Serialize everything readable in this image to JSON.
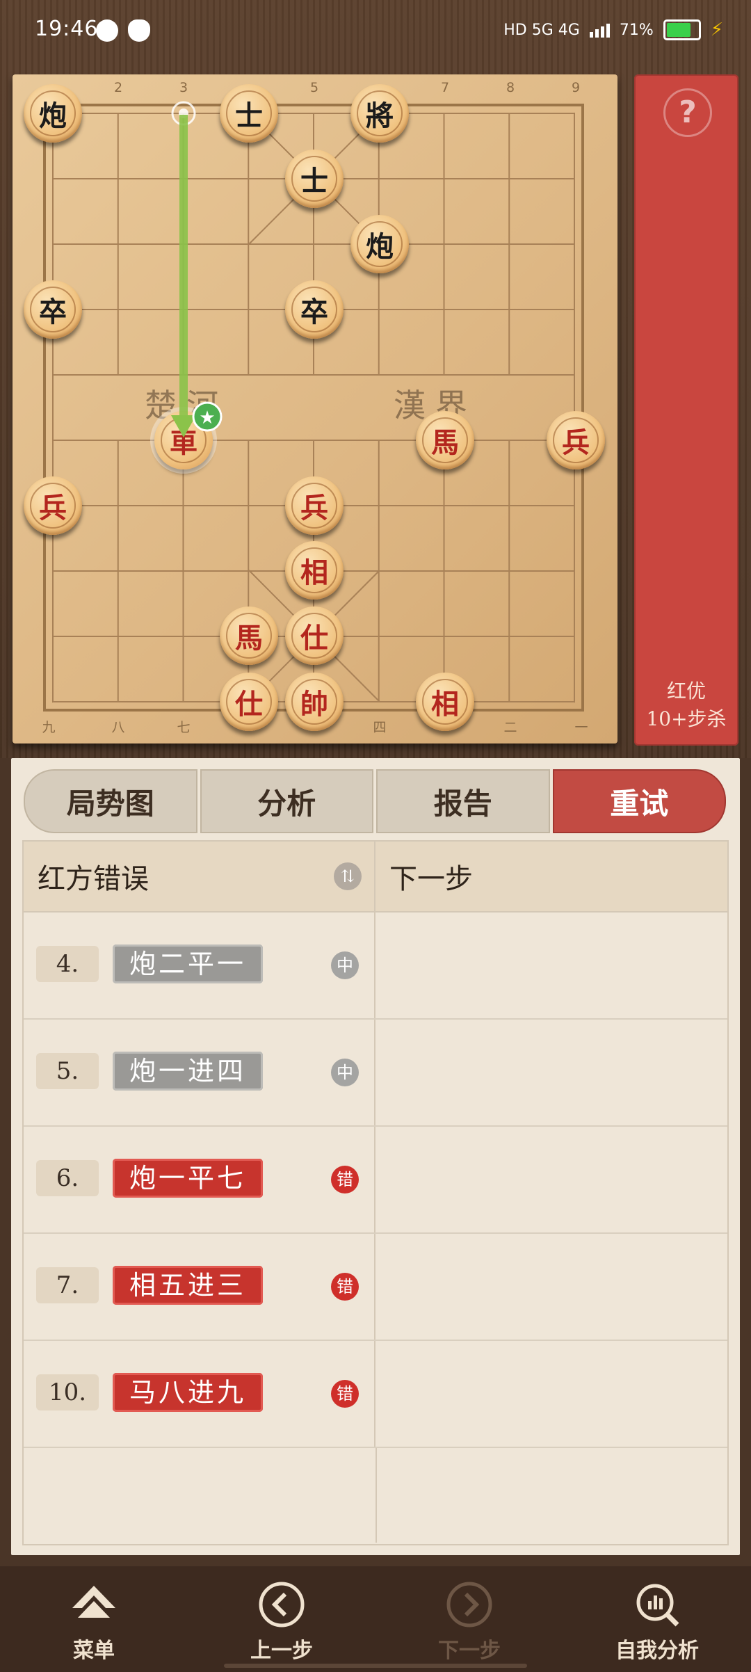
{
  "status_bar": {
    "time": "19:46",
    "network": "HD 5G 4G",
    "battery": "71%",
    "battery_level": 0.71
  },
  "board": {
    "top_file_labels": [
      "2",
      "3",
      "5",
      "7",
      "8",
      "9"
    ],
    "bottom_file_labels": [
      "九",
      "八",
      "七",
      "四",
      "二",
      "一"
    ],
    "river_left": "楚河",
    "river_right": "漢界",
    "pieces": [
      {
        "char": "炮",
        "side": "black",
        "name": "black-cannon"
      },
      {
        "char": "士",
        "side": "black",
        "name": "black-advisor"
      },
      {
        "char": "將",
        "side": "black",
        "name": "black-general"
      },
      {
        "char": "士",
        "side": "black",
        "name": "black-advisor"
      },
      {
        "char": "炮",
        "side": "black",
        "name": "black-cannon"
      },
      {
        "char": "卒",
        "side": "black",
        "name": "black-soldier"
      },
      {
        "char": "卒",
        "side": "black",
        "name": "black-soldier"
      },
      {
        "char": "車",
        "side": "red",
        "name": "red-chariot-highlighted"
      },
      {
        "char": "馬",
        "side": "red",
        "name": "red-horse"
      },
      {
        "char": "兵",
        "side": "red",
        "name": "red-soldier"
      },
      {
        "char": "兵",
        "side": "red",
        "name": "red-soldier"
      },
      {
        "char": "兵",
        "side": "red",
        "name": "red-soldier"
      },
      {
        "char": "相",
        "side": "red",
        "name": "red-elephant"
      },
      {
        "char": "馬",
        "side": "red",
        "name": "red-horse"
      },
      {
        "char": "仕",
        "side": "red",
        "name": "red-advisor"
      },
      {
        "char": "仕",
        "side": "red",
        "name": "red-advisor"
      },
      {
        "char": "帥",
        "side": "red",
        "name": "red-general"
      },
      {
        "char": "相",
        "side": "red",
        "name": "red-elephant"
      }
    ]
  },
  "advantage_panel": {
    "help": "?",
    "line1": "红优",
    "line2": "10+步杀"
  },
  "tabs": [
    "局势图",
    "分析",
    "报告",
    "重试"
  ],
  "table": {
    "header_left": "红方错误",
    "header_right": "下一步",
    "sort_icon": "⇅",
    "rows": [
      {
        "num": "4.",
        "move": "炮二平一",
        "badge": "中",
        "kind": "gray"
      },
      {
        "num": "5.",
        "move": "炮一进四",
        "badge": "中",
        "kind": "gray"
      },
      {
        "num": "6.",
        "move": "炮一平七",
        "badge": "错",
        "kind": "red"
      },
      {
        "num": "7.",
        "move": "相五进三",
        "badge": "错",
        "kind": "red"
      },
      {
        "num": "10.",
        "move": "马八进九",
        "badge": "错",
        "kind": "red"
      }
    ]
  },
  "bottom_nav": {
    "menu": "菜单",
    "prev": "上一步",
    "next": "下一步",
    "self_analysis": "自我分析"
  },
  "colors": {
    "accent_red": "#c24b43",
    "error_red": "#cf2f2a",
    "arrow_green": "#8bc34a"
  }
}
